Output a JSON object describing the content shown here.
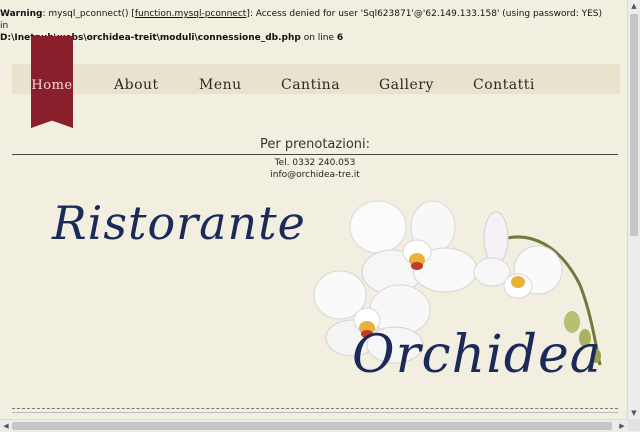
{
  "warning": {
    "label": "Warning",
    "pre_link": ": mysql_pconnect() [",
    "link_text": "function.mysql-pconnect",
    "post_link": "]: Access denied for user 'Sql623871'@'62.149.133.158' (using password: YES) in",
    "path": "D:\\Inetpub\\webs\\orchidea-treit\\moduli\\connessione_db.php",
    "on_line_text": " on line ",
    "line_number": "6"
  },
  "nav": {
    "items": [
      {
        "label": "Home",
        "active": true
      },
      {
        "label": "About"
      },
      {
        "label": "Menu"
      },
      {
        "label": "Cantina"
      },
      {
        "label": "Gallery"
      },
      {
        "label": "Contatti"
      }
    ]
  },
  "reservations": {
    "title": "Per prenotazioni:",
    "phone": "Tel. 0332 240.053",
    "email": "info@orchidea-tre.it"
  },
  "logo": {
    "word1": "Ristorante",
    "word2": "Orchidea"
  },
  "colors": {
    "background": "#f3efe0",
    "nav_active": "#8a1f2c",
    "script_text": "#1c2a5a"
  }
}
